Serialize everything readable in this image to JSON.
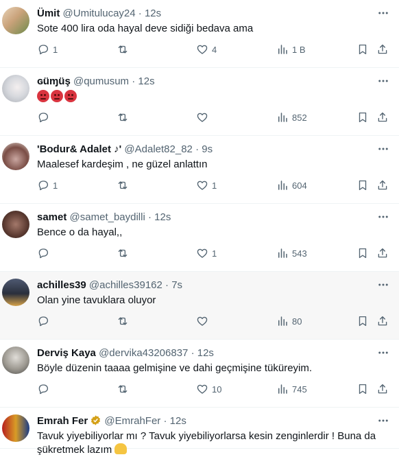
{
  "tweets": [
    {
      "name": "Ümit",
      "handle": "@Umitulucay24",
      "time": "12s",
      "text": "Sote 400 lira oda hayal deve sidiği bedava ama",
      "replies": "1",
      "retweets": "",
      "likes": "4",
      "views": "1 B"
    },
    {
      "name": "ɢüɱüş",
      "handle": "@qumusum",
      "time": "12s",
      "text": "",
      "replies": "",
      "retweets": "",
      "likes": "",
      "views": "852"
    },
    {
      "name": "'Bodur& Adalet ♪'",
      "handle": "@Adalet82_82",
      "time": "9s",
      "text": "Maalesef kardeşim , ne güzel anlattın",
      "replies": "1",
      "retweets": "",
      "likes": "1",
      "views": "604"
    },
    {
      "name": "samet",
      "handle": "@samet_baydilli",
      "time": "12s",
      "text": "Bence o da hayal,,",
      "replies": "",
      "retweets": "",
      "likes": "1",
      "views": "543"
    },
    {
      "name": "achilles39",
      "handle": "@achilles39162",
      "time": "7s",
      "text": "Olan yine tavuklara oluyor",
      "replies": "",
      "retweets": "",
      "likes": "",
      "views": "80"
    },
    {
      "name": "Derviş Kaya",
      "handle": "@dervika43206837",
      "time": "12s",
      "text": "Böyle düzenin taaaa gelmişine ve dahi geçmişine tüküreyim.",
      "replies": "",
      "retweets": "",
      "likes": "10",
      "views": "745"
    },
    {
      "name": "Emrah Fer",
      "handle": "@EmrahFer",
      "time": "12s",
      "text": "Tavuk yiyebiliyorlar mı ? Tavuk yiyebiliyorlarsa kesin zenginlerdir ! Buna da şükretmek lazım",
      "replies": "",
      "retweets": "",
      "likes": "",
      "views": ""
    }
  ],
  "separator": "·",
  "icons": {
    "reply": "reply-icon",
    "retweet": "retweet-icon",
    "like": "heart-icon",
    "views": "views-icon",
    "bookmark": "bookmark-icon",
    "share": "share-icon",
    "more": "more-icon"
  },
  "colors": {
    "muted": "#536471",
    "text": "#0f1419",
    "border": "#eff3f4",
    "hover": "#f7f7f7"
  }
}
